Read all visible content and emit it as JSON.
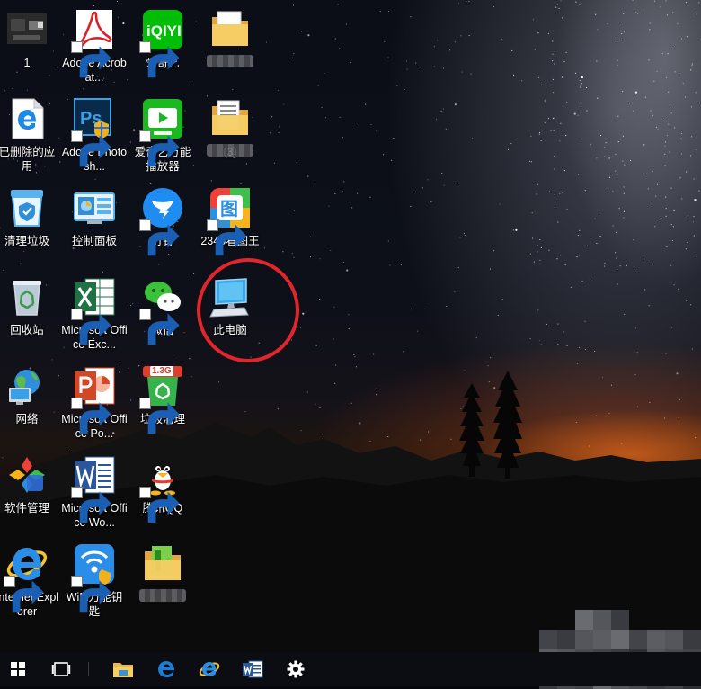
{
  "desktop": {
    "icons": [
      {
        "label": "1"
      },
      {
        "label": "已删除的应用"
      },
      {
        "label": "清理垃圾"
      },
      {
        "label": "回收站"
      },
      {
        "label": "网络"
      },
      {
        "label": "软件管理"
      },
      {
        "label": "Internet Explorer"
      },
      {
        "label": "Adobe Acrobat..."
      },
      {
        "label": "Adobe Photosh..."
      },
      {
        "label": "控制面板"
      },
      {
        "label": "Microsoft Office Exc..."
      },
      {
        "label": "Microsoft Office Po..."
      },
      {
        "label": "Microsoft Office Wo..."
      },
      {
        "label": "WiFi万能钥匙"
      },
      {
        "label": "爱奇艺"
      },
      {
        "label": "爱奇艺万能播放器"
      },
      {
        "label": "钉钉"
      },
      {
        "label": "微信"
      },
      {
        "label": "垃圾清理"
      },
      {
        "label": "腾讯QQ"
      },
      {
        "label": ""
      },
      {
        "label": ""
      },
      {
        "label": "(3)"
      },
      {
        "label": "2345看图王"
      },
      {
        "label": "此电脑"
      }
    ],
    "badges": {
      "trash_cleaner": "1.3G"
    },
    "annotation_color": "#e0262c"
  },
  "taskbar": {
    "items": [
      {
        "icon": "windows-start-icon"
      },
      {
        "icon": "task-view-icon"
      },
      {
        "icon": "file-explorer-icon"
      },
      {
        "icon": "edge-browser-icon"
      },
      {
        "icon": "internet-explorer-icon"
      },
      {
        "icon": "word-icon"
      },
      {
        "icon": "settings-gear-icon"
      }
    ]
  }
}
